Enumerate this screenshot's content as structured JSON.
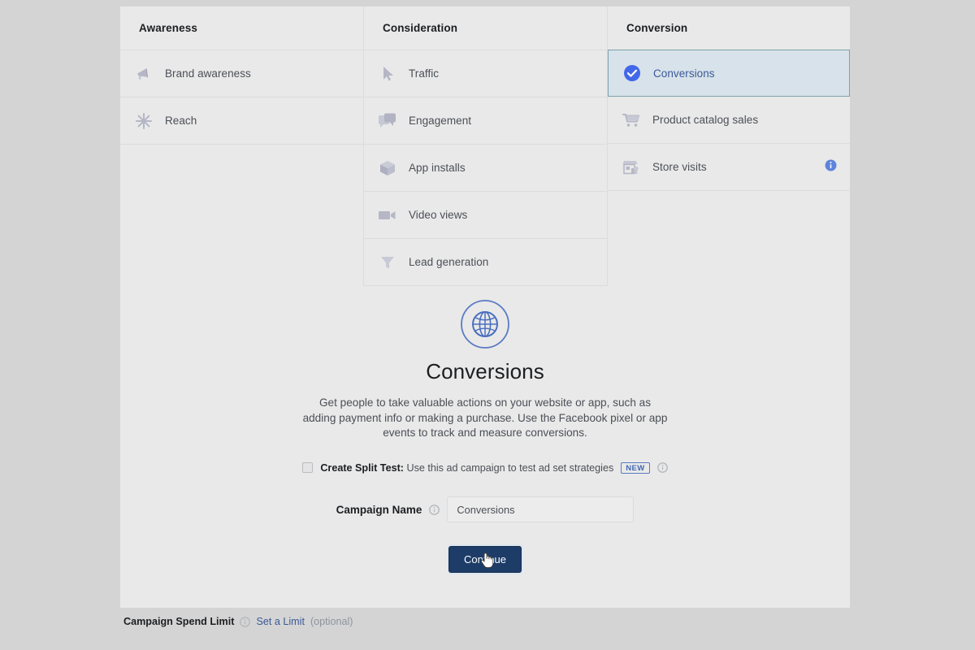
{
  "colors": {
    "page_background": "#d4d4d4",
    "panel_background": "#e9e9e9",
    "selected_row_background": "#d7e2ea",
    "selected_row_border": "#7da2ab",
    "accent_blue": "#3b5998",
    "button_blue": "#1d3c68",
    "icon_gray": "#b1b3c4",
    "info_blue": "#4267b2"
  },
  "columns": [
    {
      "header": "Awareness",
      "items": [
        {
          "label": "Brand awareness",
          "icon": "megaphone-icon",
          "selected": false,
          "info": false
        },
        {
          "label": "Reach",
          "icon": "starburst-icon",
          "selected": false,
          "info": false
        }
      ]
    },
    {
      "header": "Consideration",
      "items": [
        {
          "label": "Traffic",
          "icon": "cursor-arrow-icon",
          "selected": false,
          "info": false
        },
        {
          "label": "Engagement",
          "icon": "speech-bubbles-icon",
          "selected": false,
          "info": false
        },
        {
          "label": "App installs",
          "icon": "box-icon",
          "selected": false,
          "info": false
        },
        {
          "label": "Video views",
          "icon": "video-camera-icon",
          "selected": false,
          "info": false
        },
        {
          "label": "Lead generation",
          "icon": "funnel-icon",
          "selected": false,
          "info": false
        }
      ]
    },
    {
      "header": "Conversion",
      "items": [
        {
          "label": "Conversions",
          "icon": "check-circle-icon",
          "selected": true,
          "info": false
        },
        {
          "label": "Product catalog sales",
          "icon": "shopping-cart-icon",
          "selected": false,
          "info": false
        },
        {
          "label": "Store visits",
          "icon": "storefront-icon",
          "selected": false,
          "info": true
        }
      ]
    }
  ],
  "hero": {
    "icon": "globe-icon",
    "title": "Conversions",
    "description": "Get people to take valuable actions on your website or app, such as adding payment info or making a purchase. Use the Facebook pixel or app events to track and measure conversions."
  },
  "split_test": {
    "checked": false,
    "label_bold": "Create Split Test:",
    "label_rest": "Use this ad campaign to test ad set strategies",
    "badge": "NEW",
    "info_icon": "info-icon"
  },
  "campaign_name": {
    "label": "Campaign Name",
    "info_icon": "info-icon",
    "value": "Conversions",
    "placeholder": "Campaign Name"
  },
  "continue_button": {
    "label": "Continue",
    "cursor": "pointing-hand-cursor"
  },
  "bottom_bar": {
    "label": "Campaign Spend Limit",
    "info_icon": "info-icon",
    "link": "Set a Limit",
    "optional": "(optional)"
  }
}
